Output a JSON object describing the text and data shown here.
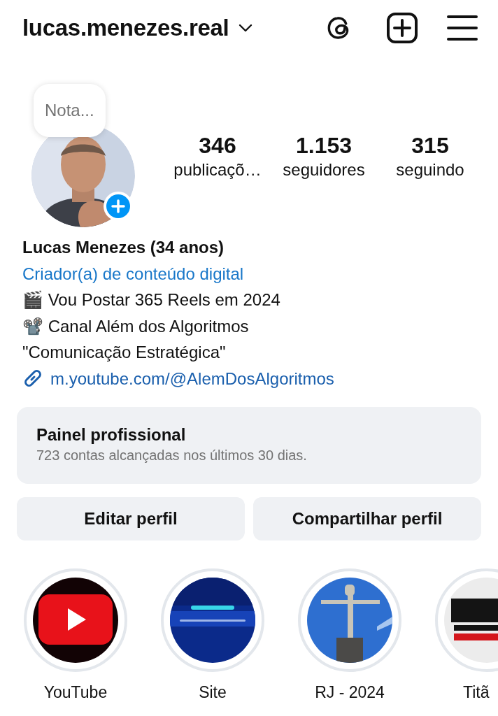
{
  "header": {
    "username": "lucas.menezes.real"
  },
  "profile": {
    "note": "Nota...",
    "stats": [
      {
        "value": "346",
        "label": "publicaçõ…"
      },
      {
        "value": "1.153",
        "label": "seguidores"
      },
      {
        "value": "315",
        "label": "seguindo"
      }
    ]
  },
  "bio": {
    "name": "Lucas Menezes (34 anos)",
    "category": "Criador(a) de conteúdo digital",
    "lines": [
      "🎬 Vou Postar 365 Reels em 2024",
      "📽️ Canal Além dos Algoritmos",
      "\"Comunicação Estratégica\""
    ],
    "link": "m.youtube.com/@AlemDosAlgoritmos"
  },
  "dashboard": {
    "title": "Painel profissional",
    "subtitle": "723 contas alcançadas nos últimos 30 dias."
  },
  "buttons": [
    "Editar perfil",
    "Compartilhar perfil"
  ],
  "highlights": [
    {
      "label": "YouTube"
    },
    {
      "label": "Site"
    },
    {
      "label": "RJ - 2024"
    },
    {
      "label": "Titã"
    }
  ]
}
